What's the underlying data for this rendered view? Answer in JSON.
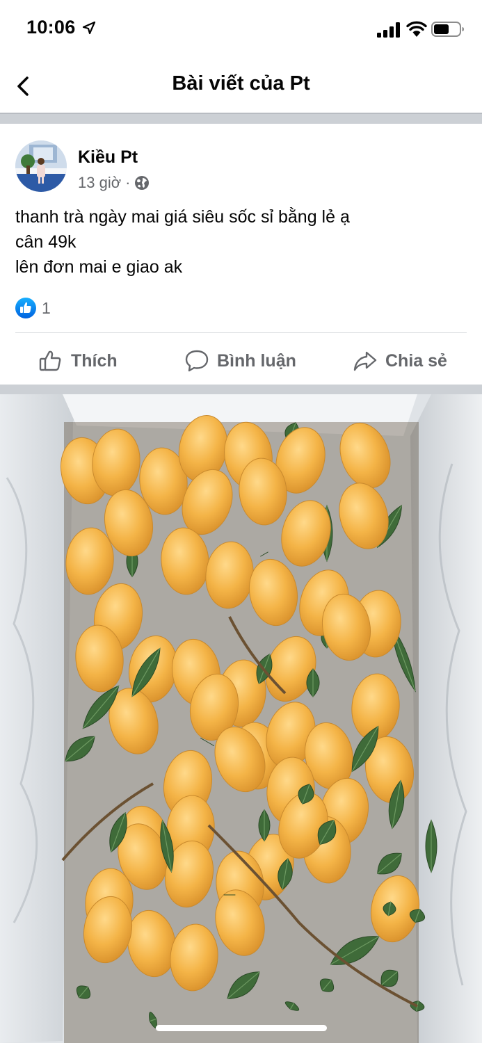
{
  "status_bar": {
    "time": "10:06",
    "icons": [
      "location-arrow-icon",
      "cellular-signal-icon",
      "wifi-icon",
      "battery-icon"
    ]
  },
  "header": {
    "back_icon": "chevron-left-icon",
    "title": "Bài viết của Pt"
  },
  "post": {
    "author": "Kiều Pt",
    "time": "13 giờ",
    "separator": "·",
    "audience_icon": "globe-icon",
    "text_lines": [
      "thanh trà ngày mai giá siêu sốc sỉ bằng lẻ ạ",
      "cân 49k",
      "lên đơn mai e giao ak"
    ],
    "reactions": {
      "icon": "like-reaction-icon",
      "count": "1"
    },
    "actions": {
      "like": "Thích",
      "comment": "Bình luận",
      "share": "Chia sẻ"
    }
  },
  "photo": {
    "icon": "fruit-photo"
  },
  "colors": {
    "facebook_blue": "#1877f2",
    "secondary_text": "#65676b",
    "divider": "#ccd0d5",
    "fruit": "#f2b752",
    "leaf": "#3d6b37"
  }
}
